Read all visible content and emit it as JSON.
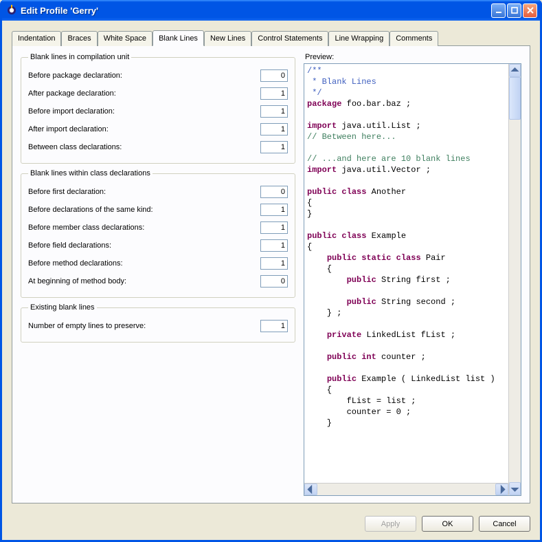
{
  "window": {
    "title": "Edit Profile 'Gerry'"
  },
  "tabs": {
    "items": [
      "Indentation",
      "Braces",
      "White Space",
      "Blank Lines",
      "New Lines",
      "Control Statements",
      "Line Wrapping",
      "Comments"
    ],
    "active_index": 3
  },
  "groups": {
    "compilation_unit": {
      "legend": "Blank lines in compilation unit",
      "rows": [
        {
          "label": "Before package declaration:",
          "value": "0"
        },
        {
          "label": "After package declaration:",
          "value": "1"
        },
        {
          "label": "Before import declaration:",
          "value": "1"
        },
        {
          "label": "After import declaration:",
          "value": "1"
        },
        {
          "label": "Between class declarations:",
          "value": "1"
        }
      ]
    },
    "class_decl": {
      "legend": "Blank lines within class declarations",
      "rows": [
        {
          "label": "Before first declaration:",
          "value": "0"
        },
        {
          "label": "Before declarations of the same kind:",
          "value": "1"
        },
        {
          "label": "Before member class declarations:",
          "value": "1"
        },
        {
          "label": "Before field declarations:",
          "value": "1"
        },
        {
          "label": "Before method declarations:",
          "value": "1"
        },
        {
          "label": "At beginning of method body:",
          "value": "0"
        }
      ]
    },
    "existing": {
      "legend": "Existing blank lines",
      "rows": [
        {
          "label": "Number of empty lines to preserve:",
          "value": "1"
        }
      ]
    }
  },
  "preview": {
    "label": "Preview:",
    "tokens": [
      {
        "t": "/**",
        "c": "doc"
      },
      {
        "t": "\n"
      },
      {
        "t": " * Blank Lines",
        "c": "doc"
      },
      {
        "t": "\n"
      },
      {
        "t": " */",
        "c": "doc"
      },
      {
        "t": "\n"
      },
      {
        "t": "package",
        "c": "kw"
      },
      {
        "t": " foo.bar.baz ;"
      },
      {
        "t": "\n"
      },
      {
        "t": "\n"
      },
      {
        "t": "import",
        "c": "kw"
      },
      {
        "t": " java.util.List ;"
      },
      {
        "t": "\n"
      },
      {
        "t": "// Between here...",
        "c": "cm"
      },
      {
        "t": "\n"
      },
      {
        "t": "\n"
      },
      {
        "t": "// ...and here are 10 blank lines",
        "c": "cm"
      },
      {
        "t": "\n"
      },
      {
        "t": "import",
        "c": "kw"
      },
      {
        "t": " java.util.Vector ;"
      },
      {
        "t": "\n"
      },
      {
        "t": "\n"
      },
      {
        "t": "public",
        "c": "kw"
      },
      {
        "t": " "
      },
      {
        "t": "class",
        "c": "kw"
      },
      {
        "t": " Another"
      },
      {
        "t": "\n"
      },
      {
        "t": "{"
      },
      {
        "t": "\n"
      },
      {
        "t": "}"
      },
      {
        "t": "\n"
      },
      {
        "t": "\n"
      },
      {
        "t": "public",
        "c": "kw"
      },
      {
        "t": " "
      },
      {
        "t": "class",
        "c": "kw"
      },
      {
        "t": " Example"
      },
      {
        "t": "\n"
      },
      {
        "t": "{"
      },
      {
        "t": "\n"
      },
      {
        "t": "    "
      },
      {
        "t": "public",
        "c": "kw"
      },
      {
        "t": " "
      },
      {
        "t": "static",
        "c": "kw"
      },
      {
        "t": " "
      },
      {
        "t": "class",
        "c": "kw"
      },
      {
        "t": " Pair"
      },
      {
        "t": "\n"
      },
      {
        "t": "    {"
      },
      {
        "t": "\n"
      },
      {
        "t": "        "
      },
      {
        "t": "public",
        "c": "kw"
      },
      {
        "t": " String first ;"
      },
      {
        "t": "\n"
      },
      {
        "t": "\n"
      },
      {
        "t": "        "
      },
      {
        "t": "public",
        "c": "kw"
      },
      {
        "t": " String second ;"
      },
      {
        "t": "\n"
      },
      {
        "t": "    } ;"
      },
      {
        "t": "\n"
      },
      {
        "t": "\n"
      },
      {
        "t": "    "
      },
      {
        "t": "private",
        "c": "kw"
      },
      {
        "t": " LinkedList fList ;"
      },
      {
        "t": "\n"
      },
      {
        "t": "\n"
      },
      {
        "t": "    "
      },
      {
        "t": "public",
        "c": "kw"
      },
      {
        "t": " "
      },
      {
        "t": "int",
        "c": "kw"
      },
      {
        "t": " counter ;"
      },
      {
        "t": "\n"
      },
      {
        "t": "\n"
      },
      {
        "t": "    "
      },
      {
        "t": "public",
        "c": "kw"
      },
      {
        "t": " Example ( LinkedList list )"
      },
      {
        "t": "\n"
      },
      {
        "t": "    {"
      },
      {
        "t": "\n"
      },
      {
        "t": "        fList = list ;"
      },
      {
        "t": "\n"
      },
      {
        "t": "        counter = 0 ;"
      },
      {
        "t": "\n"
      },
      {
        "t": "    }"
      },
      {
        "t": "\n"
      }
    ]
  },
  "buttons": {
    "apply": "Apply",
    "ok": "OK",
    "cancel": "Cancel"
  }
}
